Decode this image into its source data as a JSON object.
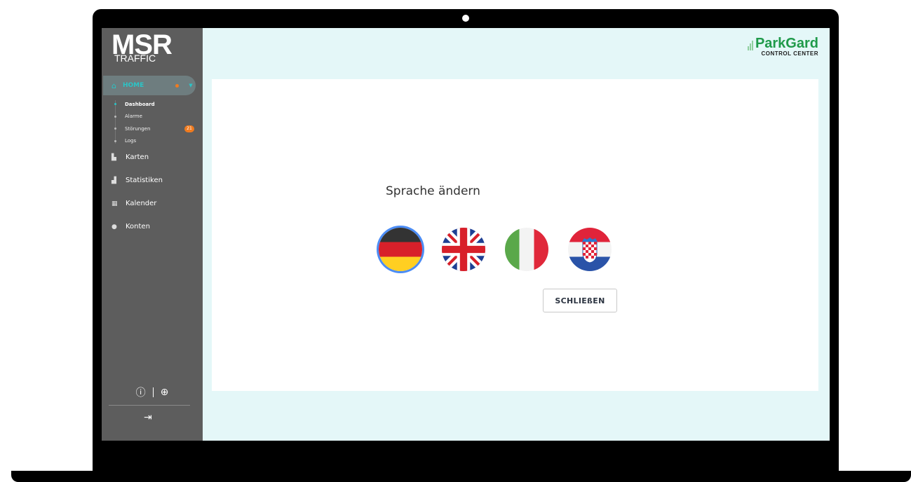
{
  "sidebar": {
    "logo_main": "MSR",
    "logo_sub": "TRAFFIC",
    "home": {
      "label": "HOME",
      "icon": "home-icon"
    },
    "subnav": [
      {
        "label": "Dashboard",
        "active": true
      },
      {
        "label": "Alarme"
      },
      {
        "label": "Störungen",
        "badge": "21"
      },
      {
        "label": "Logs"
      }
    ],
    "items": [
      {
        "label": "Karten",
        "icon": "map-icon"
      },
      {
        "label": "Statistiken",
        "icon": "chart-icon"
      },
      {
        "label": "Kalender",
        "icon": "calendar-icon"
      },
      {
        "label": "Konten",
        "icon": "users-icon"
      }
    ],
    "bottom": {
      "info_icon": "info-icon",
      "language_icon": "globe-icon",
      "logout_icon": "logout-icon"
    }
  },
  "brand": {
    "name": "ParkGard",
    "subtitle": "CONTROL CENTER",
    "color": "#1f9a4a"
  },
  "dialog": {
    "title": "Sprache ändern",
    "languages": [
      {
        "code": "de",
        "flag": "germany-flag",
        "selected": true
      },
      {
        "code": "en",
        "flag": "uk-flag"
      },
      {
        "code": "it",
        "flag": "italy-flag"
      },
      {
        "code": "hr",
        "flag": "croatia-flag"
      }
    ],
    "close_label": "SCHLIEßEN"
  },
  "colors": {
    "accent": "#2bc4c6",
    "badge": "#f07b1f",
    "sidebar_bg": "#5d5d5d",
    "screen_bg": "#e4f7f8",
    "selection_ring": "#4b8cf5"
  }
}
